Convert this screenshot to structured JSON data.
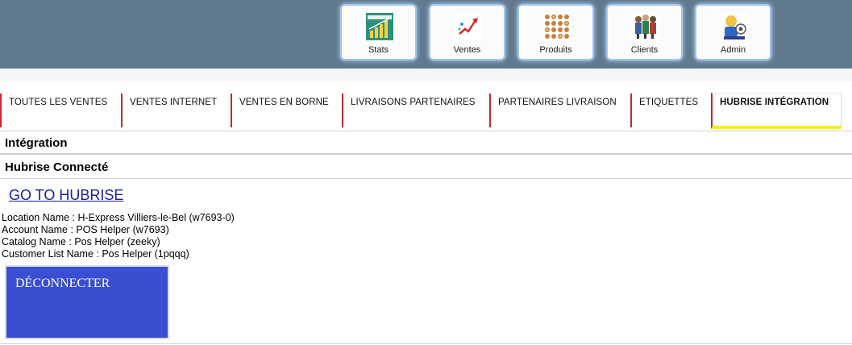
{
  "modules": [
    {
      "label": "Stats",
      "icon": "stats-chart-icon"
    },
    {
      "label": "Ventes",
      "icon": "sales-trend-icon"
    },
    {
      "label": "Produits",
      "icon": "products-grid-icon"
    },
    {
      "label": "Clients",
      "icon": "clients-group-icon"
    },
    {
      "label": "Admin",
      "icon": "admin-user-icon"
    }
  ],
  "tabs": [
    {
      "label": "TOUTES LES VENTES"
    },
    {
      "label": "VENTES INTERNET"
    },
    {
      "label": "VENTES EN BORNE"
    },
    {
      "label": "LIVRAISONS PARTENAIRES"
    },
    {
      "label": "PARTENAIRES LIVRAISON"
    },
    {
      "label": "ETIQUETTES"
    },
    {
      "label": "HUBRISE INTÉGRATION",
      "active": true
    }
  ],
  "colors": {
    "header_bg": "#61798f",
    "tab_divider": "#c9252c",
    "active_tab_underline": "#f4f400",
    "disconnect_button": "#3a4ed2"
  },
  "section_integration": "Intégration",
  "section_connected": "Hubrise Connecté",
  "goto_link": "GO TO HUBRISE",
  "info": {
    "location": "Location Name : H-Express Villiers-le-Bel (w7693-0)",
    "account": "Account Name : POS Helper (w7693)",
    "catalog": "Catalog Name : Pos Helper (zeeky)",
    "customer_list": "Customer List Name : Pos Helper (1pqqq)"
  },
  "disconnect_label": "DÉCONNECTER"
}
